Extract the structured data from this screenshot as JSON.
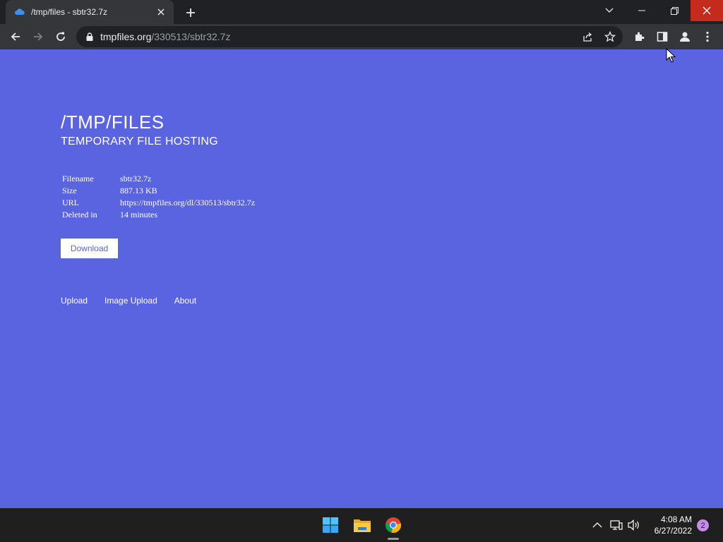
{
  "browser": {
    "tab": {
      "title": "/tmp/files - sbtr32.7z",
      "favicon": "cloud-icon"
    },
    "address_bar": {
      "host": "tmpfiles.org",
      "path": "/330513/sbtr32.7z"
    }
  },
  "page": {
    "title": "/TMP/FILES",
    "subtitle": "TEMPORARY FILE HOSTING",
    "file_info": [
      {
        "key": "Filename",
        "value": "sbtr32.7z"
      },
      {
        "key": "Size",
        "value": "887.13 KB"
      },
      {
        "key": "URL",
        "value": "https://tmpfiles.org/dl/330513/sbtr32.7z"
      },
      {
        "key": "Deleted in",
        "value": "14 minutes"
      }
    ],
    "download_label": "Download",
    "footer_links": [
      "Upload",
      "Image Upload",
      "About"
    ]
  },
  "taskbar": {
    "time": "4:08 AM",
    "date": "6/27/2022",
    "notification_count": "2"
  },
  "colors": {
    "page_background": "#5a64e0",
    "browser_frame": "#202124",
    "toolbar": "#35363a",
    "close_button": "#c42b1c"
  }
}
